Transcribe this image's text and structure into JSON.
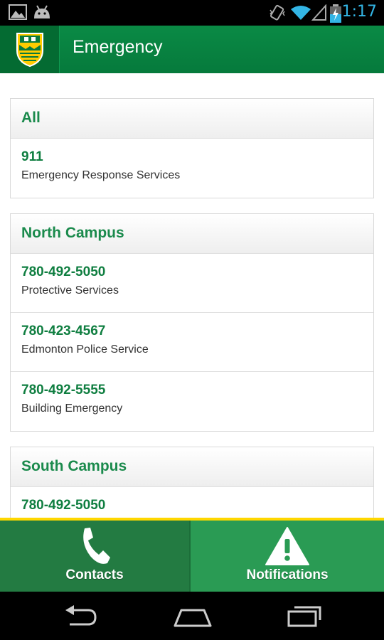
{
  "status_bar": {
    "time": "1:17",
    "icons": [
      "image-icon",
      "android-icon",
      "vibrate-icon",
      "wifi-icon",
      "signal-icon",
      "battery-charging-icon"
    ]
  },
  "action_bar": {
    "title": "Emergency",
    "logo_icon": "university-crest-icon"
  },
  "sections": [
    {
      "title": "All",
      "entries": [
        {
          "phone": "911",
          "label": "Emergency Response Services"
        }
      ]
    },
    {
      "title": "North Campus",
      "entries": [
        {
          "phone": "780-492-5050",
          "label": "Protective Services"
        },
        {
          "phone": "780-423-4567",
          "label": "Edmonton Police Service"
        },
        {
          "phone": "780-492-5555",
          "label": "Building Emergency"
        }
      ]
    },
    {
      "title": "South Campus",
      "entries": [
        {
          "phone": "780-492-5050",
          "label": ""
        }
      ]
    }
  ],
  "tabs": [
    {
      "label": "Contacts",
      "icon": "phone-icon"
    },
    {
      "label": "Notifications",
      "icon": "warning-icon"
    }
  ],
  "colors": {
    "brand_green": "#0a8a45",
    "accent_gold": "#ffd700",
    "text_green": "#1a8a4c"
  }
}
